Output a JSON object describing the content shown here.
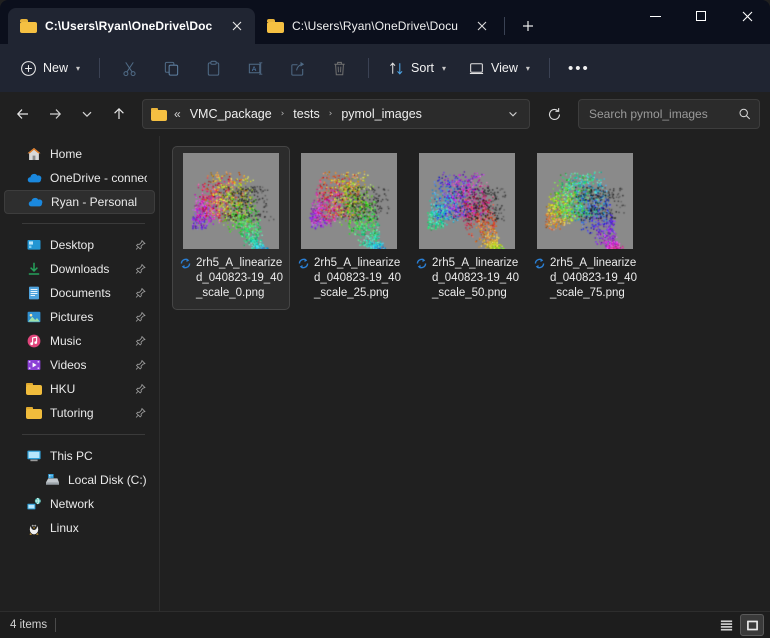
{
  "window": {
    "tabs": [
      {
        "title": "C:\\Users\\Ryan\\OneDrive\\Docı",
        "active": true
      },
      {
        "title": "C:\\Users\\Ryan\\OneDrive\\Docu",
        "active": false
      }
    ],
    "new_tab_label": "+",
    "controls": {
      "minimize": "—",
      "maximize": "☐",
      "close": "✕"
    }
  },
  "toolbar": {
    "new_label": "New",
    "sort_label": "Sort",
    "view_label": "View",
    "more_label": "•••",
    "icons": [
      "cut-icon",
      "copy-icon",
      "paste-icon",
      "rename-icon",
      "share-icon",
      "delete-icon"
    ]
  },
  "addressbar": {
    "back": "←",
    "forward": "→",
    "recent": "⌄",
    "up": "↑",
    "overflow": "«",
    "crumbs": [
      "VMC_package",
      "tests",
      "pymol_images"
    ],
    "separator": "›",
    "refresh": "↻"
  },
  "search": {
    "placeholder": "Search pymol_images",
    "value": ""
  },
  "sidebar": {
    "items": [
      {
        "label": "Home",
        "icon": "home-icon",
        "pinned": false,
        "selected": false,
        "indent": false
      },
      {
        "label": "OneDrive - connect.h",
        "icon": "onedrive-icon",
        "pinned": false,
        "selected": false,
        "indent": false
      },
      {
        "label": "Ryan - Personal",
        "icon": "onedrive-icon",
        "pinned": false,
        "selected": true,
        "indent": false
      },
      {
        "separator": true
      },
      {
        "label": "Desktop",
        "icon": "desktop-icon",
        "pinned": true,
        "selected": false,
        "indent": false
      },
      {
        "label": "Downloads",
        "icon": "downloads-icon",
        "pinned": true,
        "selected": false,
        "indent": false
      },
      {
        "label": "Documents",
        "icon": "documents-icon",
        "pinned": true,
        "selected": false,
        "indent": false
      },
      {
        "label": "Pictures",
        "icon": "pictures-icon",
        "pinned": true,
        "selected": false,
        "indent": false
      },
      {
        "label": "Music",
        "icon": "music-icon",
        "pinned": true,
        "selected": false,
        "indent": false
      },
      {
        "label": "Videos",
        "icon": "videos-icon",
        "pinned": true,
        "selected": false,
        "indent": false
      },
      {
        "label": "HKU",
        "icon": "folder-icon",
        "pinned": true,
        "selected": false,
        "indent": false
      },
      {
        "label": "Tutoring",
        "icon": "folder-icon",
        "pinned": true,
        "selected": false,
        "indent": false
      },
      {
        "separator": true
      },
      {
        "label": "This PC",
        "icon": "thispc-icon",
        "pinned": false,
        "selected": false,
        "indent": false
      },
      {
        "label": "Local Disk (C:)",
        "icon": "drive-icon",
        "pinned": false,
        "selected": false,
        "indent": true
      },
      {
        "label": "Network",
        "icon": "network-icon",
        "pinned": false,
        "selected": false,
        "indent": false
      },
      {
        "label": "Linux",
        "icon": "linux-icon",
        "pinned": false,
        "selected": false,
        "indent": false
      }
    ],
    "pin_glyph": "📌"
  },
  "files": [
    {
      "name": "2rh5_A_linearized_040823-19_40_scale_0.png",
      "status_icon": "onedrive-sync-icon",
      "selected": true,
      "seed": 11
    },
    {
      "name": "2rh5_A_linearized_040823-19_40_scale_25.png",
      "status_icon": "onedrive-sync-icon",
      "selected": false,
      "seed": 27
    },
    {
      "name": "2rh5_A_linearized_040823-19_40_scale_50.png",
      "status_icon": "onedrive-sync-icon",
      "selected": false,
      "seed": 53
    },
    {
      "name": "2rh5_A_linearized_040823-19_40_scale_75.png",
      "status_icon": "onedrive-sync-icon",
      "selected": false,
      "seed": 79
    }
  ],
  "statusbar": {
    "item_count": "4 items",
    "views": [
      {
        "name": "list-view-button",
        "active": false
      },
      {
        "name": "large-icons-view-button",
        "active": true
      }
    ]
  },
  "colors": {
    "titlebar_bg": "#0b0f1c",
    "commandbar_bg": "#202532",
    "window_bg": "#202020",
    "accent_blue": "#4da6e8",
    "folder_yellow": "#f5c042",
    "thumb_bg": "#8a8a8a",
    "selection_bg": "#2e2e2e"
  }
}
